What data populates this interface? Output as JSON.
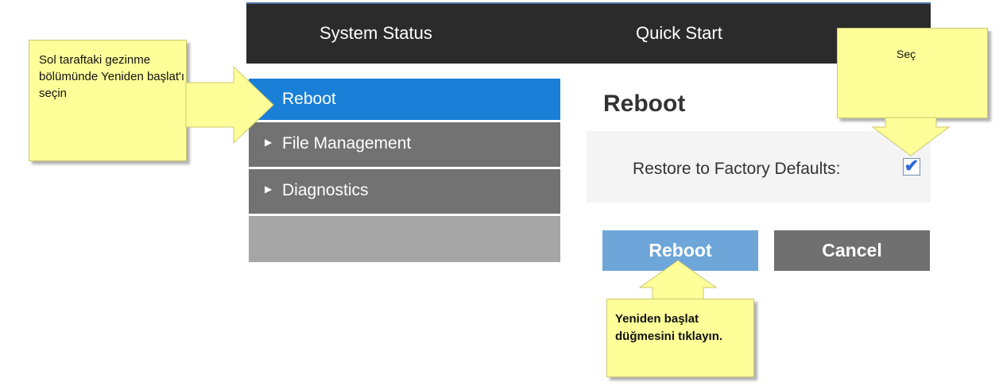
{
  "topbar": {
    "tabs": [
      "System Status",
      "Quick Start"
    ]
  },
  "sidebar": {
    "items": [
      {
        "label": "Reboot",
        "active": true
      },
      {
        "label": "File Management",
        "active": false
      },
      {
        "label": "Diagnostics",
        "active": false
      }
    ]
  },
  "main": {
    "title": "Reboot",
    "restore_label": "Restore to Factory Defaults:",
    "restore_checked": true,
    "reboot_button": "Reboot",
    "cancel_button": "Cancel"
  },
  "callouts": {
    "left": "Sol taraftaki gezinme bölümünde Yeniden başlat'ı seçin",
    "top_right": "Seç",
    "bottom": "Yeniden başlat düğmesini tıklayın."
  },
  "colors": {
    "topbar": "#2b2b2b",
    "active_nav": "#1a7fd6",
    "nav_item": "#727272",
    "reboot_button": "#6ea6d9",
    "cancel_button": "#707070",
    "callout": "#ffff99"
  },
  "icons": {
    "checkbox": "checkmark-icon",
    "nav_arrow": "triangle-right-icon"
  }
}
